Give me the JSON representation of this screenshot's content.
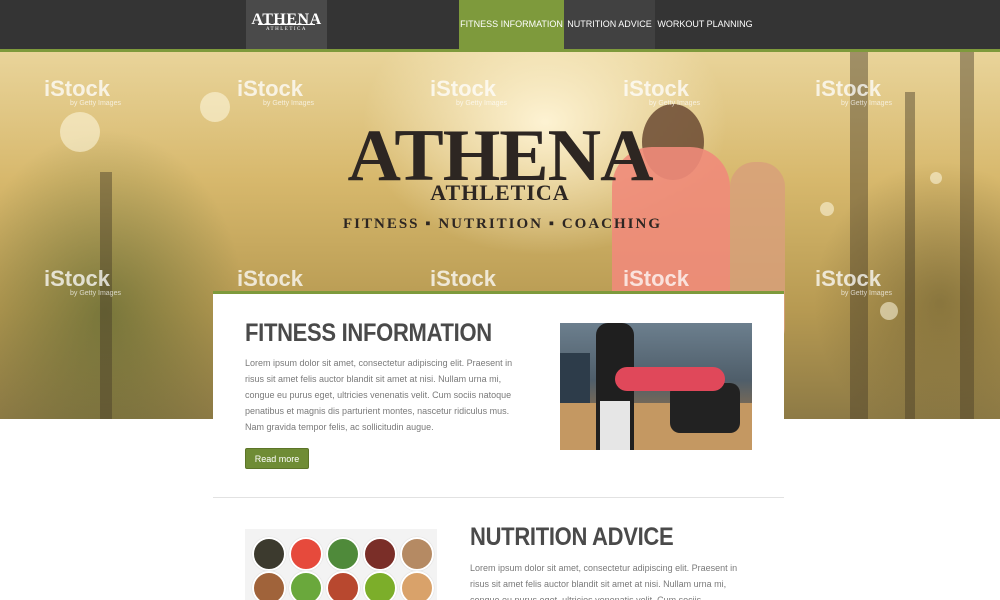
{
  "nav": {
    "logo_main": "ATHENA",
    "logo_sub": "ATHLETICA",
    "items": [
      {
        "label": "FITNESS INFORMATION",
        "active": true
      },
      {
        "label": "NUTRITION ADVICE",
        "active": false
      },
      {
        "label": "WORKOUT PLANNING",
        "active": false
      }
    ]
  },
  "hero": {
    "brand_title": "ATHENA",
    "brand_subtitle": "ATHLETICA",
    "tagline": "FITNESS ▪ NUTRITION ▪ COACHING",
    "watermark_text": "iStock",
    "watermark_sub": "by Getty Images"
  },
  "sections": {
    "fitness": {
      "heading": "FITNESS INFORMATION",
      "body": "Lorem ipsum dolor sit amet, consectetur adipiscing elit. Praesent in risus sit amet felis auctor blandit sit amet at nisi. Nullam urna mi, congue eu purus eget, ultricies venenatis velit. Cum sociis natoque penatibus et magnis dis parturient montes, nascetur ridiculus mus. Nam gravida tempor felis, ac sollicitudin augue.",
      "button_label": "Read more"
    },
    "nutrition": {
      "heading": "NUTRITION ADVICE",
      "body": "Lorem ipsum dolor sit amet, consectetur adipiscing elit. Praesent in risus sit amet felis auctor blandit sit amet at nisi. Nullam urna mi, congue eu purus eget, ultricies venenatis velit. Cum sociis"
    }
  },
  "colors": {
    "accent": "#7e9a3c",
    "nav_bg": "#343434",
    "heading": "#4a4a4a",
    "body_text": "#7a7a7a"
  },
  "icons": {
    "logo": "athena-athletica-logo"
  }
}
